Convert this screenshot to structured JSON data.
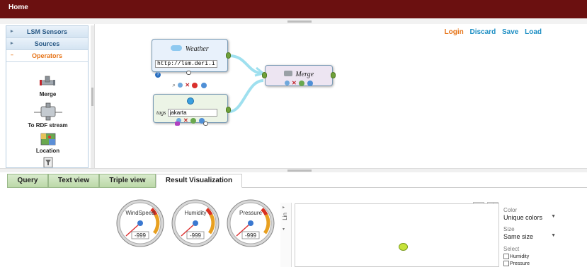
{
  "topbar": {
    "home_label": "Home"
  },
  "sidebar": {
    "sections": [
      {
        "label": "LSM Sensors"
      },
      {
        "label": "Sources"
      },
      {
        "label": "Operators"
      }
    ],
    "operators": [
      {
        "label": "Merge"
      },
      {
        "label": "To RDF stream"
      },
      {
        "label": "Location"
      }
    ]
  },
  "toolbar": {
    "login": "Login",
    "discard": "Discard",
    "save": "Save",
    "load": "Load"
  },
  "nodes": {
    "weather": {
      "title": "Weather",
      "url_value": "http://lsm.deri.ie/r"
    },
    "tags": {
      "field_label": "tags",
      "value": "jakarta"
    },
    "merge": {
      "title": "Merge"
    }
  },
  "tabs": [
    {
      "label": "Query"
    },
    {
      "label": "Text view"
    },
    {
      "label": "Triple view"
    },
    {
      "label": "Result Visualization"
    }
  ],
  "gauges": [
    {
      "label": "WindSpeed",
      "value": "-999"
    },
    {
      "label": "Humidity",
      "value": "-999"
    },
    {
      "label": "Pressure",
      "value": "-999"
    }
  ],
  "side_panel": {
    "label": "Lin"
  },
  "controls": {
    "color_label": "Color",
    "color_value": "Unique colors",
    "size_label": "Size",
    "size_value": "Same size",
    "select_label": "Select",
    "options": [
      "Humidity",
      "Pressure"
    ]
  },
  "colors": {
    "topbar": "#6b1010",
    "accent_orange": "#e67317",
    "link_blue": "#1e8fc4",
    "point": "#c6e23a"
  }
}
